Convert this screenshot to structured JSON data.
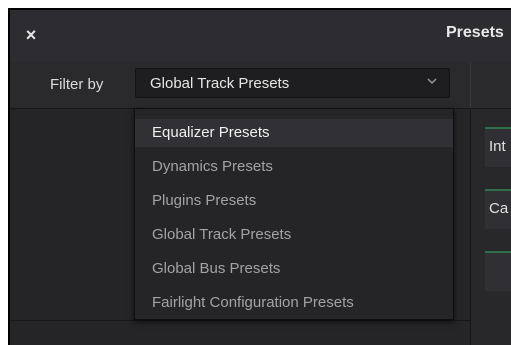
{
  "window": {
    "close_glyph": "×",
    "title": "Presets"
  },
  "filter": {
    "label": "Filter by",
    "selected_value": "Global Track Presets",
    "chevron_icon": "chevron-down-icon"
  },
  "dropdown": {
    "items": [
      {
        "label": "Equalizer Presets",
        "highlighted": true
      },
      {
        "label": "Dynamics Presets",
        "highlighted": false
      },
      {
        "label": "Plugins Presets",
        "highlighted": false
      },
      {
        "label": "Global Track Presets",
        "highlighted": false
      },
      {
        "label": "Global Bus Presets",
        "highlighted": false
      },
      {
        "label": "Fairlight Configuration Presets",
        "highlighted": false
      }
    ]
  },
  "right_panel": {
    "buttons": [
      {
        "label": "Int"
      },
      {
        "label": "Ca"
      },
      {
        "label": ""
      }
    ]
  },
  "colors": {
    "background": "#232326",
    "accent_green": "#2f6f49",
    "highlight": "#303035"
  }
}
